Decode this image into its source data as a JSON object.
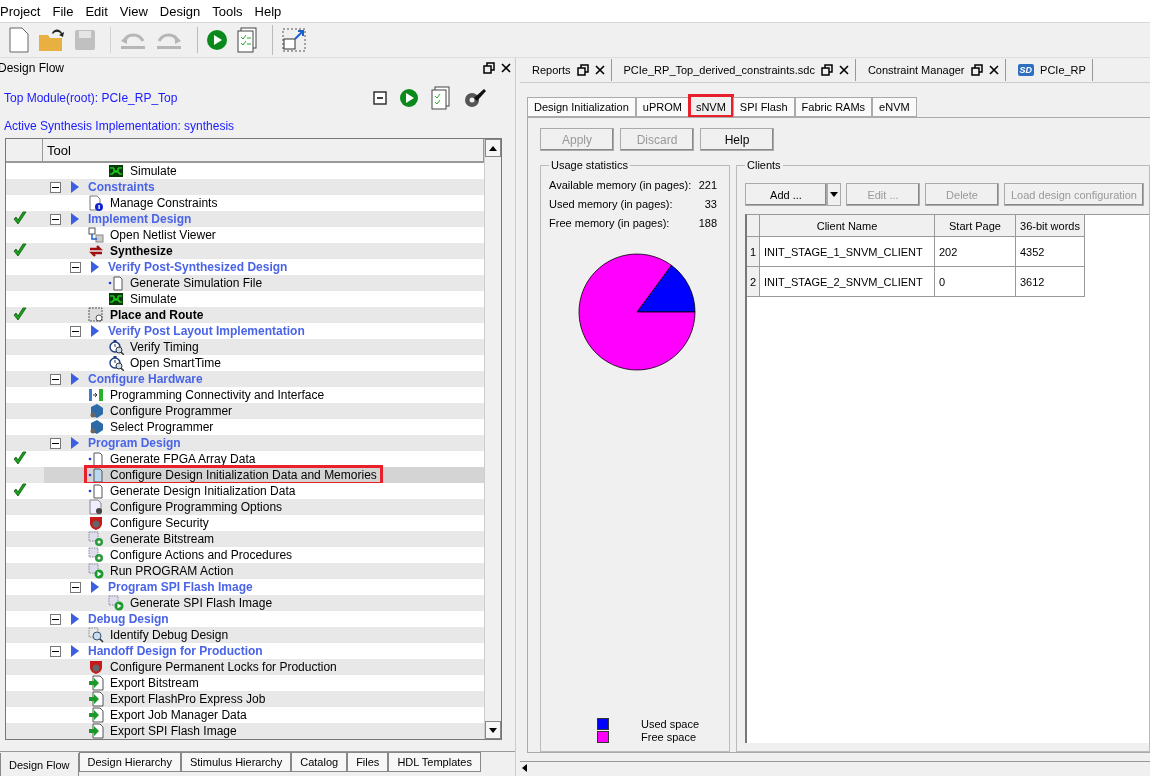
{
  "menu": [
    "Project",
    "File",
    "Edit",
    "View",
    "Design",
    "Tools",
    "Help"
  ],
  "toolbar": [
    {
      "kind": "new",
      "disabled": false
    },
    {
      "kind": "open",
      "disabled": false
    },
    {
      "kind": "save",
      "disabled": true
    },
    {
      "kind": "undo",
      "disabled": true
    },
    {
      "kind": "redo",
      "disabled": true
    },
    {
      "kind": "run",
      "disabled": false
    },
    {
      "kind": "report",
      "disabled": false
    },
    {
      "kind": "window",
      "disabled": false
    }
  ],
  "design_flow": {
    "title": "Design Flow",
    "top_module": "Top Module(root): PCIe_RP_Top",
    "active_synthesis": "Active Synthesis Implementation: synthesis",
    "column": "Tool",
    "tree": [
      {
        "kind": "spacer",
        "children": [
          {
            "kind": "spacer",
            "children": [
              {
                "kind": "wave",
                "label": "Simulate",
                "done": false,
                "bold": false,
                "selected": false,
                "marked": false
              }
            ]
          }
        ]
      },
      {
        "kind": "category",
        "label": "Constraints",
        "done": false,
        "expanded": true,
        "children": [
          {
            "kind": "doc-info",
            "label": "Manage Constraints",
            "done": false,
            "bold": false,
            "selected": false,
            "marked": false
          }
        ]
      },
      {
        "kind": "category",
        "label": "Implement Design",
        "done": true,
        "expanded": true,
        "children": [
          {
            "kind": "netlist",
            "label": "Open Netlist Viewer",
            "done": false,
            "bold": false,
            "selected": false,
            "marked": false
          },
          {
            "kind": "synth",
            "label": "Synthesize",
            "done": true,
            "bold": true,
            "selected": false,
            "marked": false
          },
          {
            "kind": "category",
            "label": "Verify Post-Synthesized Design",
            "done": false,
            "expanded": true,
            "children": [
              {
                "kind": "dot-doc",
                "label": "Generate Simulation File",
                "done": false,
                "bold": false,
                "selected": false,
                "marked": false
              },
              {
                "kind": "wave",
                "label": "Simulate",
                "done": false,
                "bold": false,
                "selected": false,
                "marked": false
              }
            ]
          },
          {
            "kind": "place",
            "label": "Place and Route",
            "done": true,
            "bold": true,
            "selected": false,
            "marked": false
          },
          {
            "kind": "category",
            "label": "Verify Post Layout Implementation",
            "done": false,
            "expanded": true,
            "children": [
              {
                "kind": "timer",
                "label": "Verify Timing",
                "done": false,
                "bold": false,
                "selected": false,
                "marked": false
              },
              {
                "kind": "timer",
                "label": "Open SmartTime",
                "done": false,
                "bold": false,
                "selected": false,
                "marked": false
              }
            ]
          }
        ]
      },
      {
        "kind": "category",
        "label": "Configure Hardware",
        "done": false,
        "expanded": true,
        "children": [
          {
            "kind": "connect",
            "label": "Programming Connectivity and Interface",
            "done": false,
            "bold": false,
            "selected": false,
            "marked": false
          },
          {
            "kind": "programmer",
            "label": "Configure Programmer",
            "done": false,
            "bold": false,
            "selected": false,
            "marked": false
          },
          {
            "kind": "programmer",
            "label": "Select Programmer",
            "done": false,
            "bold": false,
            "selected": false,
            "marked": false
          }
        ]
      },
      {
        "kind": "category",
        "label": "Program Design",
        "done": false,
        "expanded": true,
        "children": [
          {
            "kind": "dot-doc",
            "label": "Generate FPGA Array Data",
            "done": true,
            "bold": false,
            "selected": false,
            "marked": false
          },
          {
            "kind": "dot-doc-blue",
            "label": "Configure Design Initialization Data and Memories",
            "done": false,
            "bold": false,
            "selected": true,
            "marked": true
          },
          {
            "kind": "dot-doc",
            "label": "Generate Design Initialization Data",
            "done": true,
            "bold": false,
            "selected": false,
            "marked": false
          },
          {
            "kind": "options",
            "label": "Configure Programming Options",
            "done": false,
            "bold": false,
            "selected": false,
            "marked": false
          },
          {
            "kind": "shield",
            "label": "Configure Security",
            "done": false,
            "bold": false,
            "selected": false,
            "marked": false
          },
          {
            "kind": "grid-gear",
            "label": "Generate Bitstream",
            "done": false,
            "bold": false,
            "selected": false,
            "marked": false
          },
          {
            "kind": "grid-gear",
            "label": "Configure Actions and Procedures",
            "done": false,
            "bold": false,
            "selected": false,
            "marked": false
          },
          {
            "kind": "grid-run",
            "label": "Run PROGRAM Action",
            "done": false,
            "bold": false,
            "selected": false,
            "marked": false
          },
          {
            "kind": "category",
            "label": "Program SPI Flash Image",
            "done": false,
            "expanded": true,
            "children": [
              {
                "kind": "grid-run",
                "label": "Generate SPI Flash Image",
                "done": false,
                "bold": false,
                "selected": false,
                "marked": false
              }
            ]
          }
        ]
      },
      {
        "kind": "category",
        "label": "Debug Design",
        "done": false,
        "expanded": true,
        "children": [
          {
            "kind": "debug",
            "label": "Identify Debug Design",
            "done": false,
            "bold": false,
            "selected": false,
            "marked": false
          }
        ]
      },
      {
        "kind": "category",
        "label": "Handoff Design for Production",
        "done": false,
        "expanded": true,
        "children": [
          {
            "kind": "shield",
            "label": "Configure Permanent Locks for Production",
            "done": false,
            "bold": false,
            "selected": false,
            "marked": false
          },
          {
            "kind": "export",
            "label": "Export Bitstream",
            "done": false,
            "bold": false,
            "selected": false,
            "marked": false
          },
          {
            "kind": "export",
            "label": "Export FlashPro Express Job",
            "done": false,
            "bold": false,
            "selected": false,
            "marked": false
          },
          {
            "kind": "export",
            "label": "Export Job Manager Data",
            "done": false,
            "bold": false,
            "selected": false,
            "marked": false
          },
          {
            "kind": "export",
            "label": "Export SPI Flash Image",
            "done": false,
            "bold": false,
            "selected": false,
            "marked": false
          }
        ]
      }
    ]
  },
  "bottom_tabs": [
    {
      "label": "Design Flow",
      "selected": true
    },
    {
      "label": "Design Hierarchy",
      "selected": false
    },
    {
      "label": "Stimulus Hierarchy",
      "selected": false
    },
    {
      "label": "Catalog",
      "selected": false
    },
    {
      "label": "Files",
      "selected": false
    },
    {
      "label": "HDL Templates",
      "selected": false
    }
  ],
  "doc_tabs": [
    {
      "label": "Reports",
      "selected": false,
      "closable": true
    },
    {
      "label": "PCIe_RP_Top_derived_constraints.sdc",
      "selected": false,
      "closable": true
    },
    {
      "label": "Constraint Manager",
      "selected": false,
      "closable": true
    },
    {
      "label": "PCIe_RP",
      "badge": "SD",
      "selected": false,
      "closable": false
    }
  ],
  "config_tabs": [
    {
      "label": "Design Initialization",
      "selected": false,
      "marked": false
    },
    {
      "label": "uPROM",
      "selected": false,
      "marked": false
    },
    {
      "label": "sNVM",
      "selected": true,
      "marked": true
    },
    {
      "label": "SPI Flash",
      "selected": false,
      "marked": false
    },
    {
      "label": "Fabric RAMs",
      "selected": false,
      "marked": false
    },
    {
      "label": "eNVM",
      "selected": false,
      "marked": false
    }
  ],
  "actions": [
    {
      "label": "Apply",
      "disabled": true
    },
    {
      "label": "Discard",
      "disabled": true
    },
    {
      "label": "Help",
      "disabled": false
    }
  ],
  "usage": {
    "title": "Usage statistics",
    "stats": [
      {
        "label": "Available memory (in pages):",
        "value": "221"
      },
      {
        "label": "Used memory (in pages):",
        "value": "33"
      },
      {
        "label": "Free memory (in pages):",
        "value": "188"
      }
    ],
    "chart_data": {
      "type": "pie",
      "categories": [
        "Used space",
        "Free space"
      ],
      "values": [
        14.9,
        85.1
      ]
    },
    "legend": [
      {
        "color": "#0000ff"
      },
      {
        "color": "#ff00ff"
      }
    ]
  },
  "clients": {
    "title": "Clients",
    "buttons": [
      {
        "label": "Add ...",
        "disabled": false,
        "dropdown": true
      },
      {
        "label": "Edit ...",
        "disabled": true,
        "dropdown": false
      },
      {
        "label": "Delete",
        "disabled": true,
        "dropdown": false
      },
      {
        "label": "Load design configuration",
        "disabled": true,
        "dropdown": false
      }
    ],
    "columns": [
      "Client Name",
      "Start Page",
      "36-bit words"
    ],
    "rows": [
      {
        "number": "1",
        "cells": [
          "INIT_STAGE_1_SNVM_CLIENT",
          "202",
          "4352"
        ]
      },
      {
        "number": "2",
        "cells": [
          "INIT_STAGE_2_SNVM_CLIENT",
          "0",
          "3612"
        ]
      }
    ]
  }
}
